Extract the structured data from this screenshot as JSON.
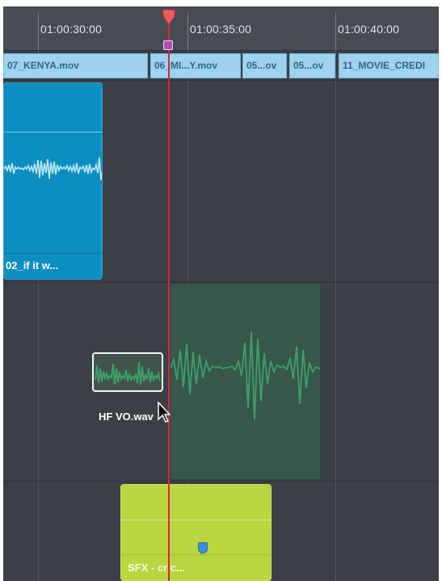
{
  "timeline": {
    "timecodes": [
      "01:00:30:00",
      "01:00:35:00",
      "01:00:40:00"
    ],
    "video_clips": [
      "07_KENYA.mov",
      "06_MI...Y.mov",
      "05...ov",
      "05...ov",
      "11_MOVIE_CREDI"
    ],
    "audio_clips": {
      "blue": "02_if it w...",
      "thumbnail": "HF VO.wav",
      "sfx": "SFX - cric..."
    }
  },
  "icons": {
    "playhead": "playhead-icon",
    "flag": "flag-icon",
    "marker": "marker-icon",
    "cursor": "cursor-icon"
  },
  "colors": {
    "background": "#3b3f46",
    "ruler": "#464b54",
    "video_clip": "#9ed2ef",
    "blue_clip": "#0d8ec0",
    "green_clip": "#365749",
    "sfx_clip": "#b8d63e",
    "playhead": "#d1293d",
    "marker": "#3c8ed8"
  }
}
